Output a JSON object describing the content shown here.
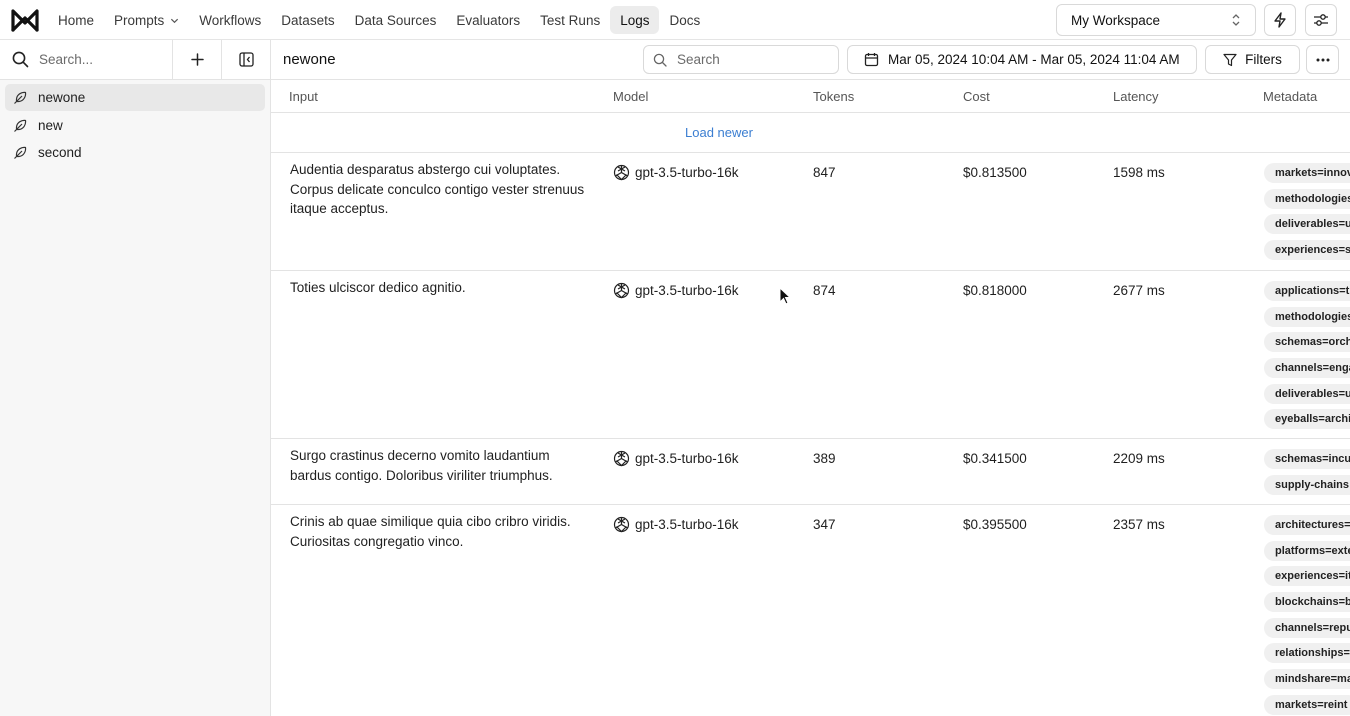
{
  "nav": {
    "items": [
      {
        "label": "Home",
        "active": false
      },
      {
        "label": "Prompts",
        "active": false,
        "dropdown": true
      },
      {
        "label": "Workflows",
        "active": false
      },
      {
        "label": "Datasets",
        "active": false
      },
      {
        "label": "Data Sources",
        "active": false
      },
      {
        "label": "Evaluators",
        "active": false
      },
      {
        "label": "Test Runs",
        "active": false
      },
      {
        "label": "Logs",
        "active": true
      },
      {
        "label": "Docs",
        "active": false
      }
    ],
    "workspace": "My Workspace"
  },
  "sidebar": {
    "search_placeholder": "Search...",
    "items": [
      {
        "label": "newone",
        "active": true
      },
      {
        "label": "new",
        "active": false
      },
      {
        "label": "second",
        "active": false
      }
    ]
  },
  "main": {
    "title": "newone",
    "search_placeholder": "Search",
    "date_range": "Mar 05, 2024 10:04 AM - Mar 05, 2024 11:04 AM",
    "filters_label": "Filters"
  },
  "table": {
    "columns": {
      "input": "Input",
      "model": "Model",
      "tokens": "Tokens",
      "cost": "Cost",
      "latency": "Latency",
      "metadata": "Metadata"
    },
    "load_newer": "Load newer",
    "rows": [
      {
        "input": "Audentia desparatus abstergo cui voluptates. Corpus delicate conculco contigo vester strenuus itaque acceptus.",
        "model": "gpt-3.5-turbo-16k",
        "tokens": "847",
        "cost": "$0.813500",
        "latency": "1598 ms",
        "metadata": [
          "markets=innov",
          "methodologies",
          "deliverables=u",
          "experiences=s"
        ]
      },
      {
        "input": "Toties ulciscor dedico agnitio.",
        "model": "gpt-3.5-turbo-16k",
        "tokens": "874",
        "cost": "$0.818000",
        "latency": "2677 ms",
        "metadata": [
          "applications=t",
          "methodologies",
          "schemas=orch",
          "channels=enga",
          "deliverables=u",
          "eyeballs=archi"
        ]
      },
      {
        "input": "Surgo crastinus decerno vomito laudantium bardus contigo. Doloribus viriliter triumphus.",
        "model": "gpt-3.5-turbo-16k",
        "tokens": "389",
        "cost": "$0.341500",
        "latency": "2209 ms",
        "metadata": [
          "schemas=incu",
          "supply-chains"
        ]
      },
      {
        "input": "Crinis ab quae similique quia cibo cribro viridis. Curiositas congregatio vinco.",
        "model": "gpt-3.5-turbo-16k",
        "tokens": "347",
        "cost": "$0.395500",
        "latency": "2357 ms",
        "metadata": [
          "architectures=",
          "platforms=exte",
          "experiences=it",
          "blockchains=b",
          "channels=repu",
          "relationships=",
          "mindshare=ma",
          "markets=reint"
        ]
      }
    ]
  }
}
